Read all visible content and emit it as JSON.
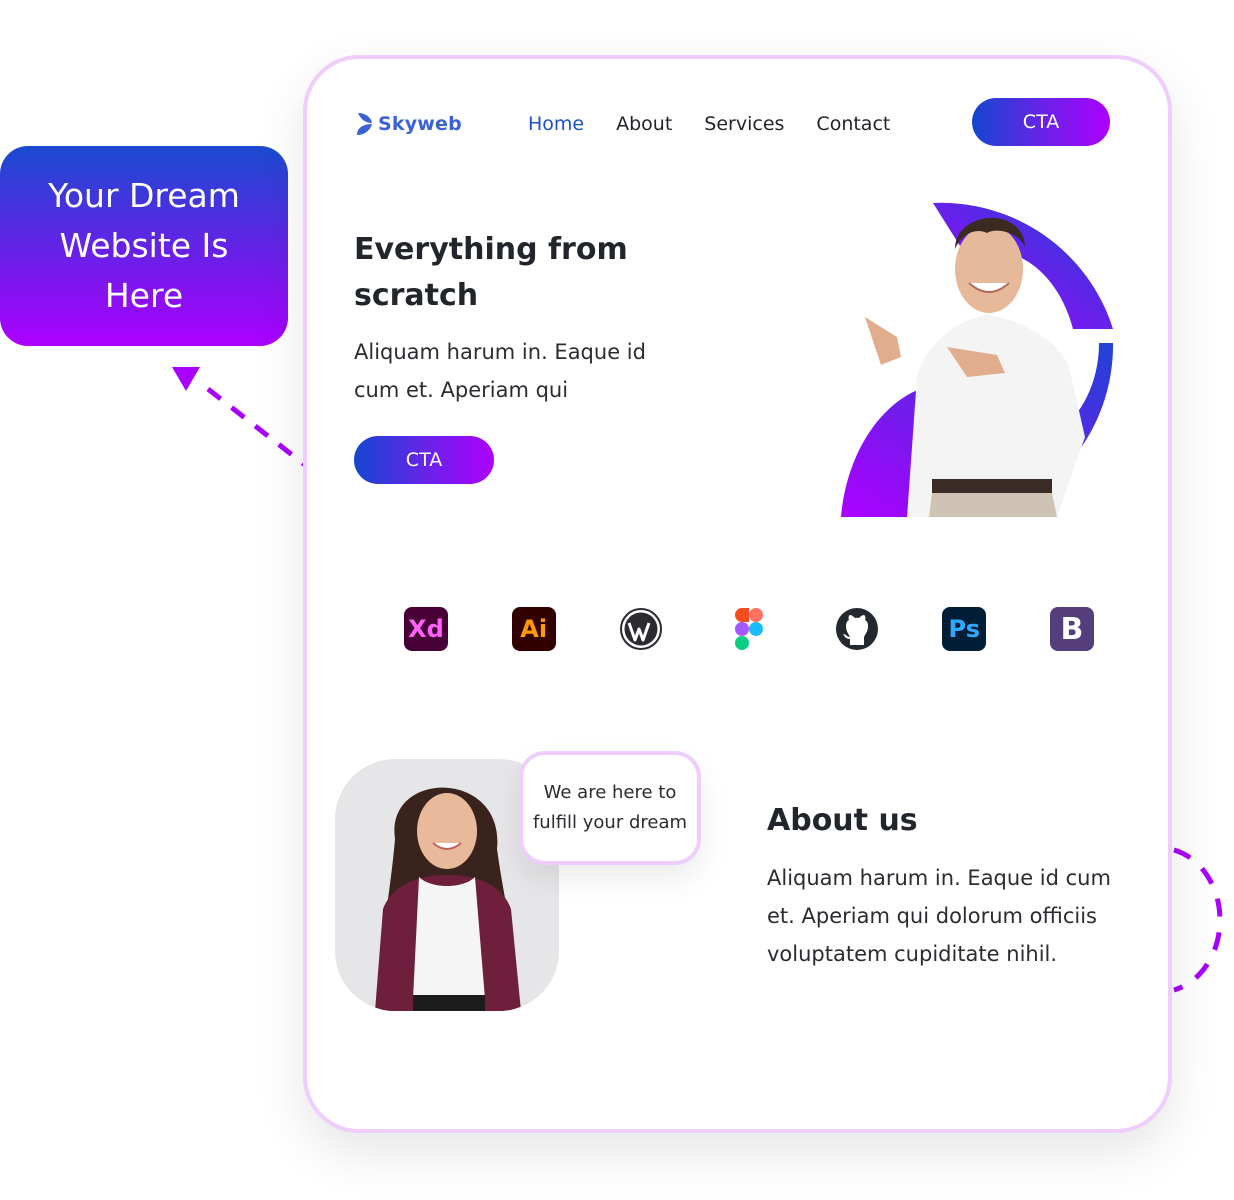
{
  "callout": {
    "lines": [
      "Your Dream",
      "Website Is",
      "Here"
    ]
  },
  "brand": {
    "name": "Skyweb",
    "logo_icon": "leaf-logo-icon",
    "color": "#3a62d6"
  },
  "nav": {
    "items": [
      {
        "label": "Home",
        "active": true
      },
      {
        "label": "About",
        "active": false
      },
      {
        "label": "Services",
        "active": false
      },
      {
        "label": "Contact",
        "active": false
      }
    ],
    "cta_label": "CTA"
  },
  "hero": {
    "title": "Everything from scratch",
    "description": "Aliquam harum in. Eaque id cum et. Aperiam qui",
    "cta_label": "CTA",
    "image": "man-pointing-photo"
  },
  "tools": [
    {
      "name": "adobe-xd-icon",
      "label": "Xd"
    },
    {
      "name": "adobe-illustrator-icon",
      "label": "Ai"
    },
    {
      "name": "wordpress-icon",
      "label": ""
    },
    {
      "name": "figma-icon",
      "label": ""
    },
    {
      "name": "github-icon",
      "label": ""
    },
    {
      "name": "photoshop-icon",
      "label": "Ps"
    },
    {
      "name": "bootstrap-icon",
      "label": "B"
    }
  ],
  "about": {
    "bubble_lines": [
      "We are here to",
      "fulfill your dream"
    ],
    "title": "About us",
    "description": "Aliquam harum in. Eaque id cum et. Aperiam qui dolorum officiis voluptatem cupiditate nihil.",
    "image": "woman-smiling-photo"
  },
  "colors": {
    "accent_start": "#1446d0",
    "accent_end": "#ad00ff",
    "frame_border": "#efcdfc",
    "nav_active": "#1e4fd0"
  }
}
